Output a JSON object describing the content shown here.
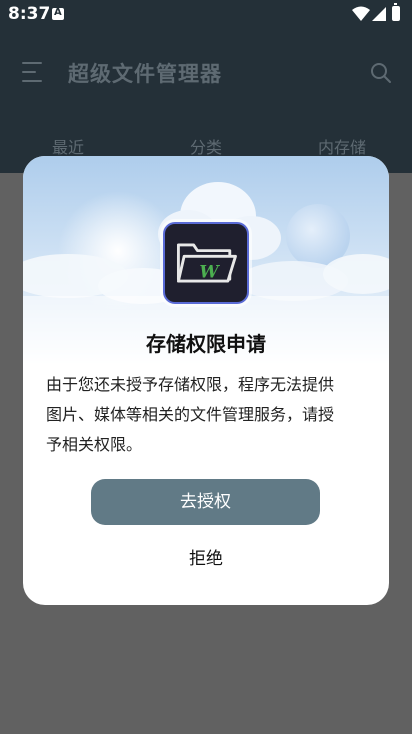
{
  "status_bar": {
    "time": "8:37",
    "icons": [
      "notification-a-icon",
      "wifi-icon",
      "signal-icon",
      "battery-icon"
    ]
  },
  "app": {
    "title": "超级文件管理器",
    "tabs": [
      {
        "label": "最近"
      },
      {
        "label": "分类"
      },
      {
        "label": "内存储"
      }
    ]
  },
  "dialog": {
    "title": "存储权限申请",
    "message_lines": [
      "由于您还未授予存储权限，程序无法提供",
      "图片、媒体等相关的文件管理服务，请授",
      "予相关权限。"
    ],
    "grant_label": "去授权",
    "deny_label": "拒绝"
  },
  "colors": {
    "header_bg": "#243038",
    "overlay_bg": "#616161",
    "grant_button": "#617a86",
    "logo_accent": "#4caf50"
  }
}
